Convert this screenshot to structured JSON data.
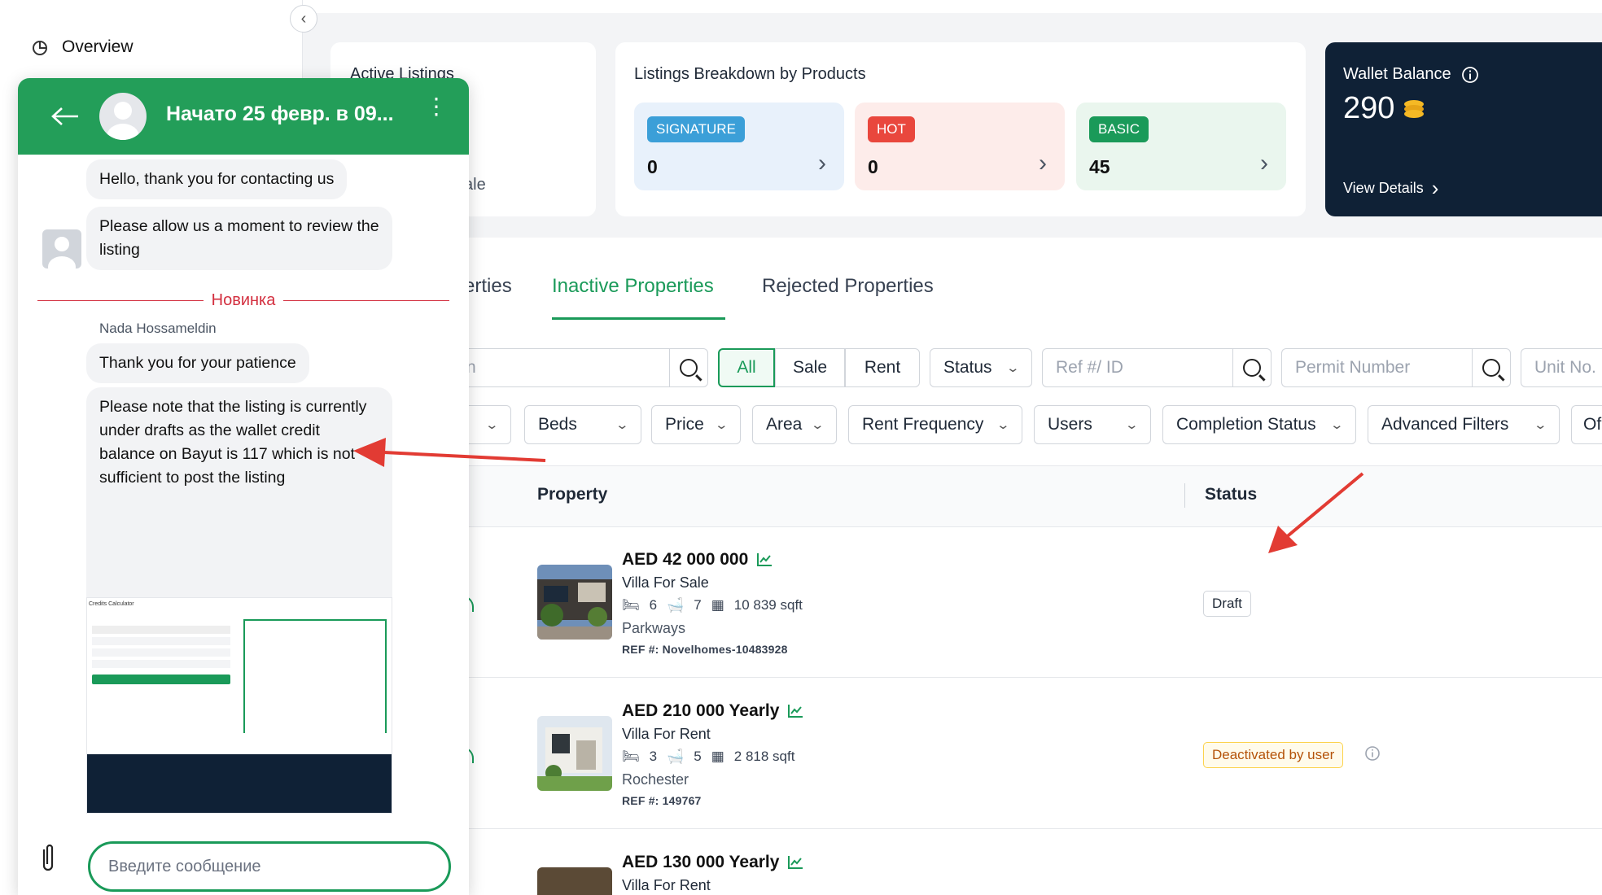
{
  "sidebar": {
    "overview_label": "Overview",
    "collapse_icon": "chevron-left-icon"
  },
  "cards": {
    "active": {
      "title": "Active Listings",
      "partial_text": "ale"
    },
    "breakdown": {
      "title": "Listings Breakdown by Products",
      "products": [
        {
          "label": "SIGNATURE",
          "count": "0",
          "color": "#3b9fd8",
          "bg": "#e8f1fb"
        },
        {
          "label": "HOT",
          "count": "0",
          "color": "#e9473d",
          "bg": "#fdecea"
        },
        {
          "label": "BASIC",
          "count": "45",
          "color": "#1a9a59",
          "bg": "#eaf6ee"
        }
      ]
    },
    "wallet": {
      "title": "Wallet Balance",
      "amount": "290",
      "link": "View Details"
    }
  },
  "tabs": {
    "partial": "erties",
    "inactive": "Inactive Properties",
    "rejected": "Rejected Properties"
  },
  "filters": {
    "search_partial": "n",
    "purpose": [
      "All",
      "Sale",
      "Rent"
    ],
    "status": "Status",
    "ref_placeholder": "Ref #/ ID",
    "permit_placeholder": "Permit Number",
    "unit_placeholder": "Unit No.",
    "dropdowns": [
      "Beds",
      "Price",
      "Area",
      "Rent Frequency",
      "Users",
      "Completion Status",
      "Advanced Filters"
    ],
    "partial_last": "Of"
  },
  "table": {
    "headers": {
      "property": "Property",
      "status": "Status"
    },
    "rows": [
      {
        "price": "AED 42 000 000",
        "type": "Villa For Sale",
        "beds": "6",
        "baths": "7",
        "area": "10 839 sqft",
        "location": "Parkways",
        "ref": "REF #: Novelhomes-10483928",
        "status": "Draft"
      },
      {
        "price": "AED 210 000 Yearly",
        "type": "Villa For Rent",
        "beds": "3",
        "baths": "5",
        "area": "2 818 sqft",
        "location": "Rochester",
        "ref": "REF #: 149767",
        "status": "Deactivated by user"
      },
      {
        "price": "AED 130 000 Yearly",
        "type": "Villa For Rent"
      }
    ]
  },
  "chat": {
    "title": "Начато 25 февр. в 09...",
    "messages": [
      "Hello, thank you for contacting us",
      "Please allow us a moment to review the listing"
    ],
    "divider": "Новинка",
    "sender": "Nada Hossameldin",
    "messages2": [
      "Thank you for your patience",
      "Please note that the listing is currently under drafts as the wallet credit balance on Bayut is 117 which is not sufficient to post the listing"
    ],
    "screenshot_title": "Credits Calculator",
    "input_placeholder": "Введите сообщение"
  }
}
